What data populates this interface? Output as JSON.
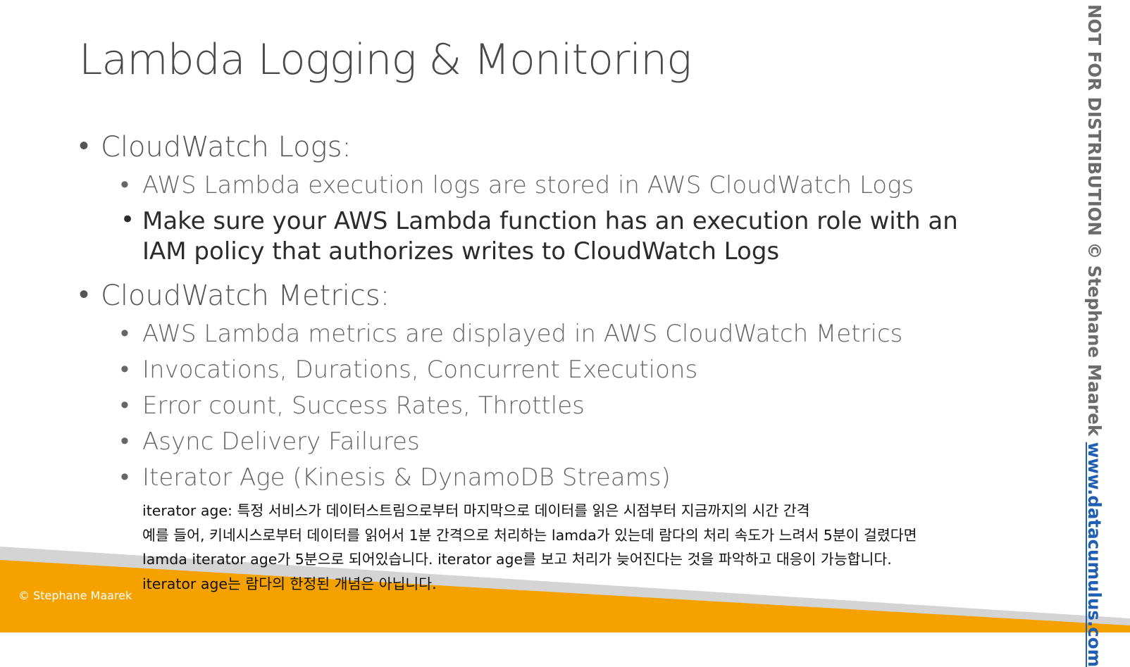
{
  "slide": {
    "title": "Lambda Logging & Monitoring",
    "sections": [
      {
        "heading": "CloudWatch Logs:",
        "items": [
          "AWS Lambda execution logs are stored in AWS CloudWatch Logs",
          "Make sure your AWS Lambda function has an execution role with an IAM policy that authorizes writes to CloudWatch Logs"
        ]
      },
      {
        "heading": "CloudWatch Metrics:",
        "items": [
          "AWS Lambda metrics are displayed in AWS CloudWatch Metrics",
          "Invocations, Durations, Concurrent Executions",
          "Error count, Success Rates, Throttles",
          "Async Delivery Failures",
          "Iterator Age (Kinesis & DynamoDB Streams)"
        ]
      }
    ],
    "bullet_glyph": "•",
    "note_lines": [
      "iterator age: 특정 서비스가 데이터스트림으로부터 마지막으로 데이터를 읽은 시점부터 지금까지의 시간 간격",
      "예를 들어, 키네시스로부터 데이터를 읽어서 1분 간격으로 처리하는 lamda가 있는데 람다의 처리 속도가 느려서 5분이 걸렸다면",
      "lamda iterator age가 5분으로 되어있습니다. iterator age를 보고 처리가 늦어진다는 것을 파악하고 대응이 가능합니다.",
      "iterator age는 람다의 한정된 개념은 아닙니다."
    ],
    "footer": "© Stephane Maarek",
    "side_label": "NOT FOR DISTRIBUTION © Stephane Maarek",
    "side_link": "www.datacumulus.com"
  },
  "colors": {
    "orange_band": "#f5a100",
    "gray_band": "#d4d4d4",
    "link": "#1f5fb3"
  }
}
